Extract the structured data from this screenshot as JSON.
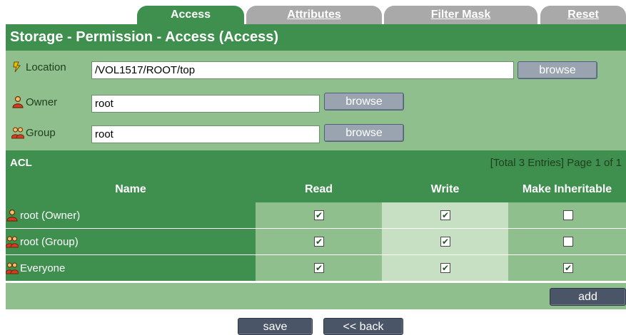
{
  "tabs": [
    {
      "label": "Access",
      "active": true
    },
    {
      "label": "Attributes",
      "active": false
    },
    {
      "label": "Filter Mask",
      "active": false
    },
    {
      "label": "Reset",
      "active": false
    }
  ],
  "title": "Storage - Permission - Access (Access)",
  "fields": {
    "location": {
      "label": "Location",
      "value": "/VOL1517/ROOT/top",
      "button": "browse"
    },
    "owner": {
      "label": "Owner",
      "value": "root",
      "button": "browse"
    },
    "group": {
      "label": "Group",
      "value": "root",
      "button": "browse"
    }
  },
  "acl": {
    "title": "ACL",
    "summary": "[Total 3 Entries] Page 1 of 1",
    "columns": [
      "Name",
      "Read",
      "Write",
      "Make Inheritable"
    ],
    "rows": [
      {
        "name": "root (Owner)",
        "icon": "user-icon",
        "read": true,
        "write": true,
        "inherit": false
      },
      {
        "name": "root (Group)",
        "icon": "group-icon",
        "read": true,
        "write": true,
        "inherit": false
      },
      {
        "name": "Everyone",
        "icon": "group-icon",
        "read": true,
        "write": true,
        "inherit": true
      }
    ],
    "add_label": "add"
  },
  "actions": {
    "save_label": "save",
    "back_label": "<< back"
  },
  "colors": {
    "dark_green": "#3f8f4e",
    "mid_green": "#8fbf8c",
    "light_green": "#c7e0c3",
    "tab_inactive": "#a9a9a9"
  }
}
